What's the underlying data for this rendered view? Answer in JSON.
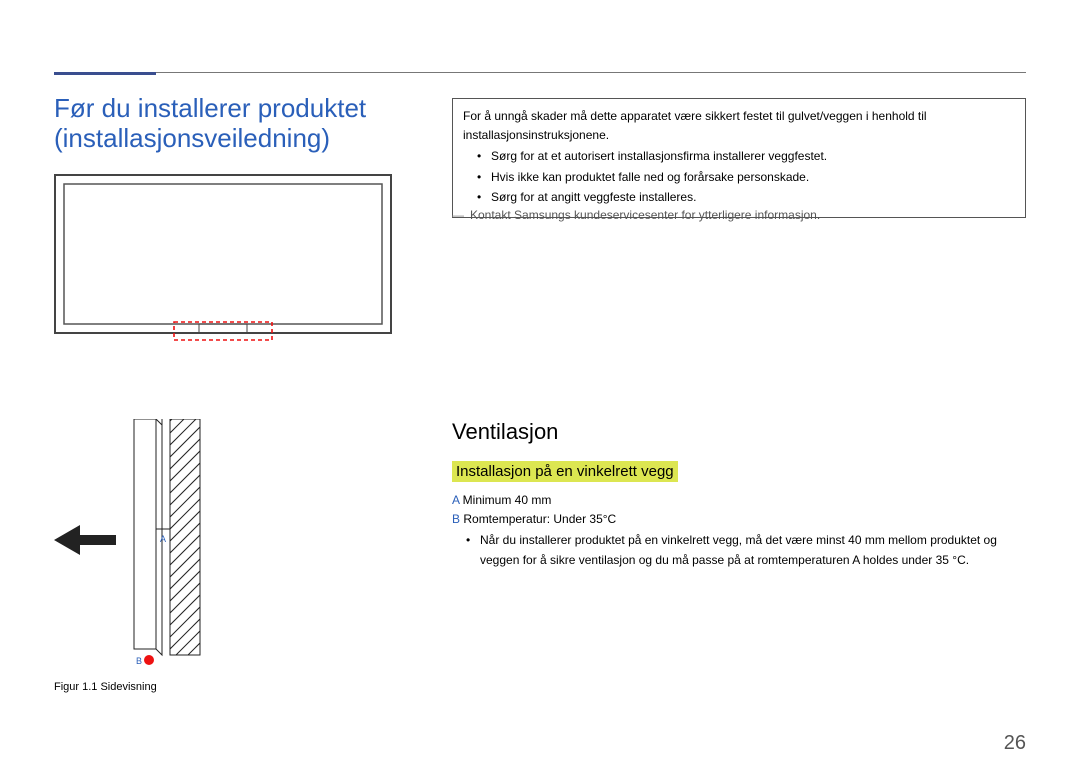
{
  "headingMain": "Før du installerer produktet (installasjonsveiledning)",
  "infobox": {
    "intro": "For å unngå skader må dette apparatet være sikkert festet til gulvet/veggen i henhold til installasjonsinstruksjonene.",
    "bullets": [
      "Sørg for at et autorisert installasjonsfirma installerer veggfestet.",
      "Hvis ikke kan produktet falle ned og forårsake personskade.",
      "Sørg for at angitt veggfeste installeres."
    ]
  },
  "note": "Kontakt Samsungs kundeservicesenter for ytterligere informasjon.",
  "section": {
    "h2": "Ventilasjon",
    "h3": "Installasjon på en vinkelrett vegg",
    "aLabel": "A",
    "aText": " Minimum 40 mm",
    "bLabel": "B",
    "bText": " Romtemperatur: Under 35°C",
    "bullet": "Når du installerer produktet på en vinkelrett vegg, må det være minst 40 mm mellom produktet og veggen for å sikre ventilasjon og du må passe på at romtemperaturen A holdes under 35 °C."
  },
  "sideCaption": "Figur 1.1 Sidevisning",
  "diagram": {
    "aLabel": "A",
    "bLabel": "B"
  },
  "pageNumber": "26"
}
